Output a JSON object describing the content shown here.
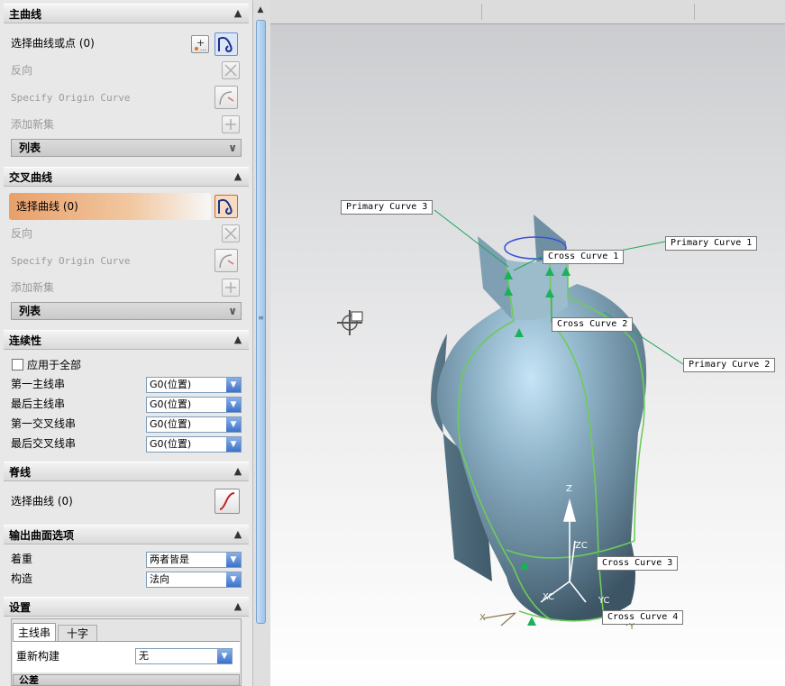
{
  "primary_section": {
    "title": "主曲线",
    "select_label": "选择曲线或点 (0)",
    "reverse_label": "反向",
    "origin_label": "Specify Origin Curve",
    "add_set_label": "添加新集",
    "list_label": "列表"
  },
  "cross_section": {
    "title": "交叉曲线",
    "select_label": "选择曲线 (0)",
    "reverse_label": "反向",
    "origin_label": "Specify Origin Curve",
    "add_set_label": "添加新集",
    "list_label": "列表"
  },
  "continuity": {
    "title": "连续性",
    "apply_all_label": "应用于全部",
    "rows": [
      {
        "label": "第一主线串",
        "value": "G0(位置)"
      },
      {
        "label": "最后主线串",
        "value": "G0(位置)"
      },
      {
        "label": "第一交叉线串",
        "value": "G0(位置)"
      },
      {
        "label": "最后交叉线串",
        "value": "G0(位置)"
      }
    ]
  },
  "spine": {
    "title": "脊线",
    "select_label": "选择曲线 (0)"
  },
  "output": {
    "title": "输出曲面选项",
    "emphasis_label": "着重",
    "emphasis_value": "两者皆是",
    "construct_label": "构造",
    "construct_value": "法向"
  },
  "settings": {
    "title": "设置",
    "tabs": [
      "主线串",
      "十字"
    ],
    "rebuild_label": "重新构建",
    "rebuild_value": "无",
    "tolerance_label": "公差"
  },
  "viewport": {
    "labels": {
      "pc3": "Primary Curve  3",
      "pc1": "Primary Curve  1",
      "pc2": "Primary Curve  2",
      "cc1": "Cross Curve  1",
      "cc2": "Cross Curve  2",
      "cc3": "Cross Curve  3",
      "cc4": "Cross Curve  4"
    },
    "axes": {
      "z": "Z",
      "zc": "ZC",
      "yc": "YC",
      "xc": "XC",
      "y": "Y",
      "x": "X"
    }
  },
  "colors": {
    "highlight": "#e9a06a",
    "combo_arrow": "#3d72c9",
    "body": "#6d8fa3",
    "curve": "#6dcc5a"
  }
}
